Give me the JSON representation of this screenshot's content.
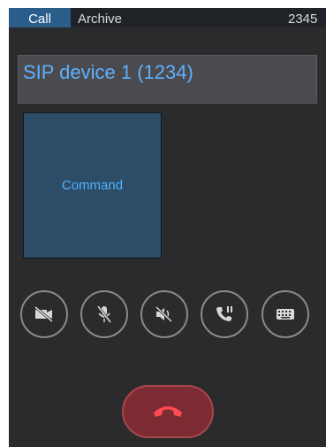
{
  "tabs": [
    {
      "label": "Call",
      "active": true
    },
    {
      "label": "Archive",
      "active": false
    },
    {
      "label": "2345",
      "active": false
    }
  ],
  "device": {
    "title": "SIP device 1 (1234)"
  },
  "command_tile": {
    "label": "Command"
  },
  "controls": [
    {
      "name": "video-off",
      "icon": "video-off-icon"
    },
    {
      "name": "mic-off",
      "icon": "mic-off-icon"
    },
    {
      "name": "speaker-off",
      "icon": "speaker-off-icon"
    },
    {
      "name": "call-hold",
      "icon": "phone-pause-icon"
    },
    {
      "name": "keypad",
      "icon": "keyboard-icon"
    }
  ],
  "hangup": {
    "icon": "hang-up-icon"
  },
  "colors": {
    "accent_text": "#5fb0ff",
    "active_tab": "#2a5d8a",
    "hangup": "#7b2b31",
    "panel_bg": "#2b2b2d"
  }
}
